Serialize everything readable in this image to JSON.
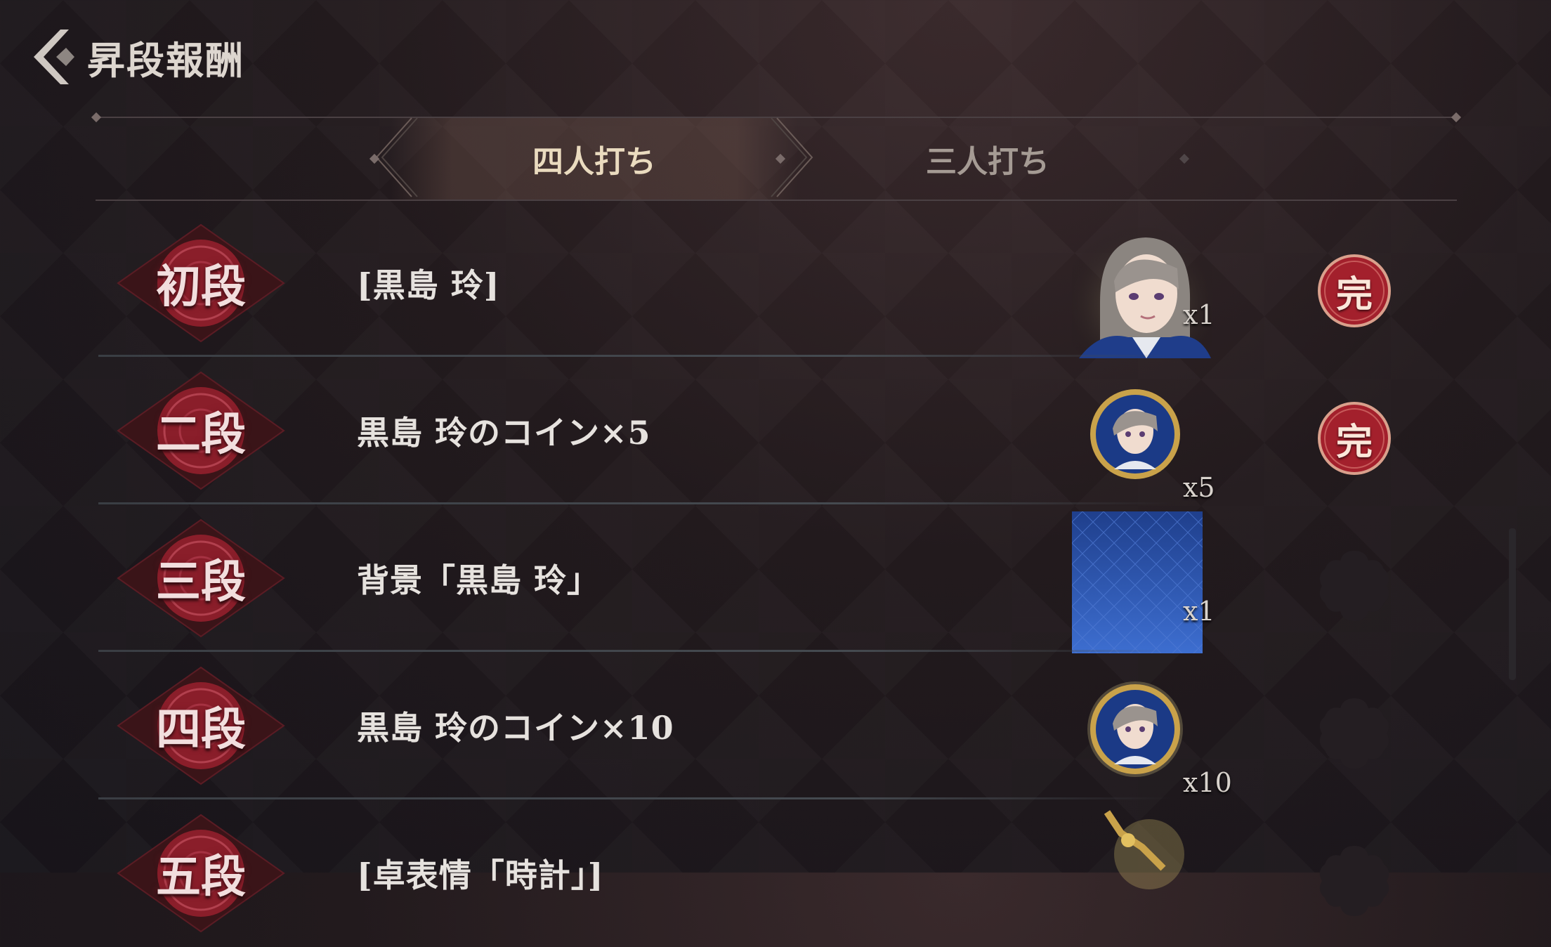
{
  "header": {
    "title": "昇段報酬"
  },
  "tabs": [
    {
      "label": "四人打ち",
      "active": true
    },
    {
      "label": "三人打ち",
      "active": false
    }
  ],
  "rows": [
    {
      "rank": "初段",
      "reward": "[黒島 玲]",
      "icon": "character-portrait",
      "qty": "x1",
      "done": "完",
      "claimed": true
    },
    {
      "rank": "二段",
      "reward": "黒島 玲のコイン×5",
      "icon": "character-coin",
      "qty": "x5",
      "done": "完",
      "claimed": true
    },
    {
      "rank": "三段",
      "reward": "背景「黒島 玲」",
      "icon": "background-tile",
      "qty": "x1",
      "done": "",
      "claimed": false
    },
    {
      "rank": "四段",
      "reward": "黒島 玲のコイン×10",
      "icon": "character-coin",
      "qty": "x10",
      "done": "",
      "claimed": false
    },
    {
      "rank": "五段",
      "reward": "[卓表情「時計」]",
      "icon": "gold-item",
      "qty": "",
      "done": "",
      "claimed": false
    }
  ],
  "colors": {
    "rank_badge": "#8a1e2a",
    "done_badge": "#a3202c",
    "accent_tab": "#eadbbf",
    "tile_blue": "#2d58b8"
  }
}
